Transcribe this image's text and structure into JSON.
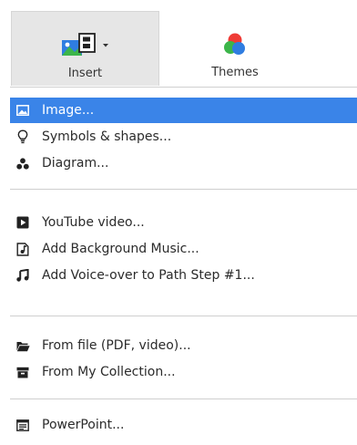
{
  "toolbar": {
    "insert": {
      "label": "Insert",
      "icon": "insert-media-icon"
    },
    "themes": {
      "label": "Themes",
      "icon": "themes-icon"
    }
  },
  "menu": {
    "items": [
      {
        "label": "Image...",
        "icon": "image-icon",
        "selected": true
      },
      {
        "label": "Symbols & shapes...",
        "icon": "lightbulb-icon"
      },
      {
        "label": "Diagram...",
        "icon": "diagram-icon"
      },
      {
        "label": "YouTube video...",
        "icon": "play-icon"
      },
      {
        "label": "Add Background Music...",
        "icon": "music-file-icon"
      },
      {
        "label": "Add Voice-over to Path Step #1...",
        "icon": "music-note-icon"
      },
      {
        "label": "From file (PDF, video)...",
        "icon": "folder-icon"
      },
      {
        "label": "From My Collection...",
        "icon": "archive-icon"
      },
      {
        "label": "PowerPoint...",
        "icon": "powerpoint-icon"
      }
    ]
  },
  "colors": {
    "selected_bg": "#3a84e8",
    "theme_red": "#ef3b36",
    "theme_green": "#3cb54a",
    "theme_blue": "#2f7de1"
  }
}
